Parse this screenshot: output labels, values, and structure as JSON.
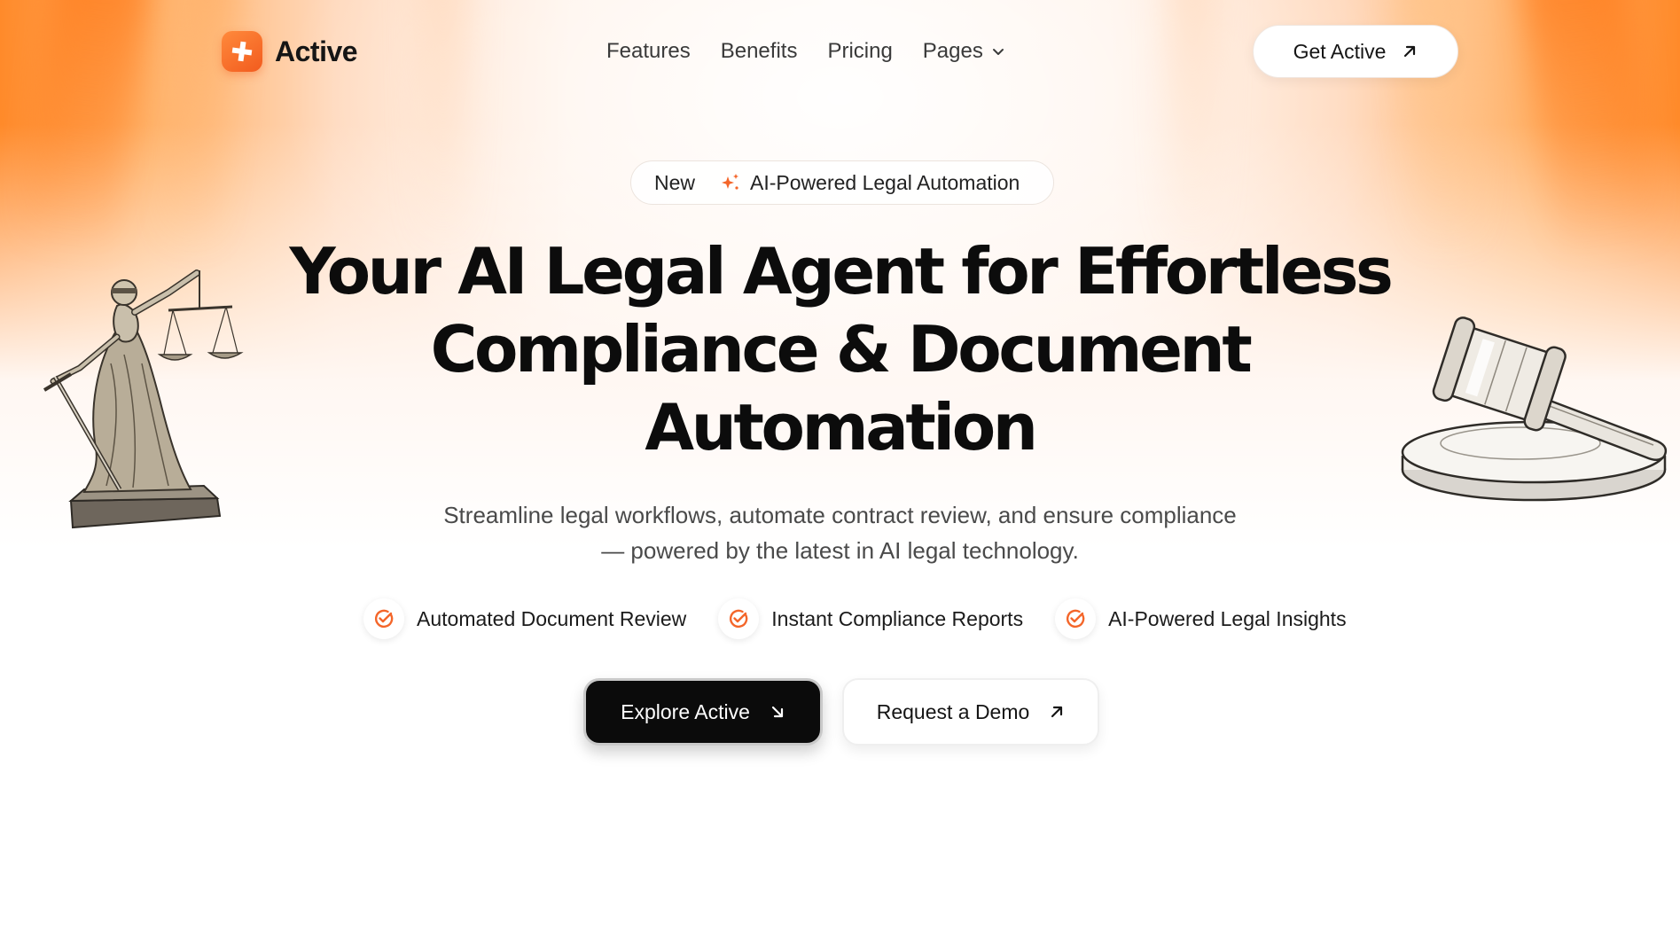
{
  "brand": {
    "name": "Active",
    "logo_icon": "plus-icon",
    "accent_color": "#F4662A"
  },
  "nav": {
    "links": [
      "Features",
      "Benefits",
      "Pricing"
    ],
    "pages_label": "Pages",
    "cta_label": "Get Active"
  },
  "badge": {
    "tag": "New",
    "text": "AI-Powered Legal Automation",
    "icon": "sparkle-icon"
  },
  "hero": {
    "headline_line1": "Your AI Legal Agent for Effortless",
    "headline_line2": "Compliance & Document",
    "headline_line3": "Automation",
    "subhead_line1": "Streamline legal workflows, automate contract review, and ensure compliance",
    "subhead_line2": "— powered by the latest in AI legal technology."
  },
  "features": [
    "Automated Document Review",
    "Instant Compliance Reports",
    "AI-Powered Legal Insights"
  ],
  "buttons": {
    "primary": "Explore Active",
    "secondary": "Request a Demo"
  },
  "illustrations": {
    "left": "lady-justice-statue",
    "right": "judge-gavel"
  }
}
